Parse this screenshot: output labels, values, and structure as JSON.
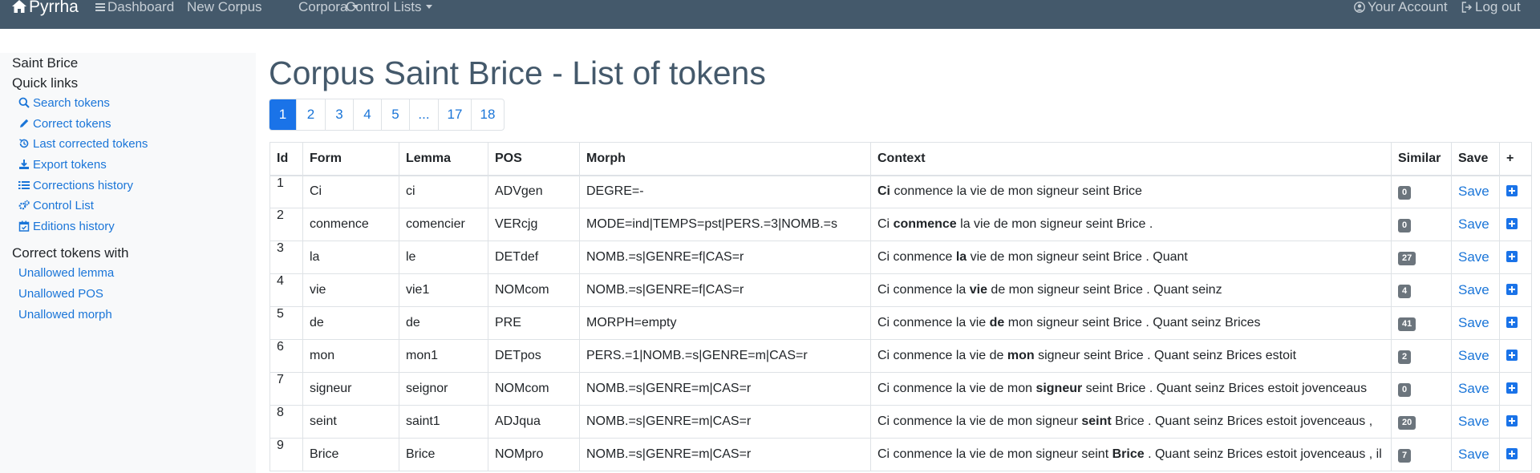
{
  "navbar": {
    "brand": "Pyrrha",
    "dashboard": "Dashboard",
    "new_corpus": "New Corpus",
    "corpora": "Corpora",
    "control_lists": "Control Lists",
    "account": "Your Account",
    "logout": "Log out"
  },
  "sidebar": {
    "corpus_name": "Saint Brice",
    "quick_links_title": "Quick links",
    "links": [
      {
        "label": "Search tokens",
        "icon": "search-icon"
      },
      {
        "label": "Correct tokens",
        "icon": "pencil-icon"
      },
      {
        "label": "Last corrected tokens",
        "icon": "history-icon"
      },
      {
        "label": "Export tokens",
        "icon": "download-icon"
      },
      {
        "label": "Corrections history",
        "icon": "list-icon"
      },
      {
        "label": "Control List",
        "icon": "cogs-icon"
      },
      {
        "label": "Editions history",
        "icon": "calendar-icon"
      }
    ],
    "correct_with_title": "Correct tokens with",
    "correct_links": [
      {
        "label": "Unallowed lemma"
      },
      {
        "label": "Unallowed POS"
      },
      {
        "label": "Unallowed morph"
      }
    ]
  },
  "main": {
    "title": "Corpus Saint Brice - List of tokens",
    "pagination": [
      "1",
      "2",
      "3",
      "4",
      "5",
      "...",
      "17",
      "18"
    ],
    "active_page": "1",
    "table": {
      "headers": [
        "Id",
        "Form",
        "Lemma",
        "POS",
        "Morph",
        "Context",
        "Similar",
        "Save",
        "+"
      ],
      "rows": [
        {
          "id": "1",
          "form": "Ci",
          "lemma": "ci",
          "pos": "ADVgen",
          "morph": "DEGRE=-",
          "ctx_before": "",
          "ctx_token": "Ci",
          "ctx_after": " conmence la vie de mon signeur seint Brice",
          "similar": "0",
          "save": "Save"
        },
        {
          "id": "2",
          "form": "conmence",
          "lemma": "comencier",
          "pos": "VERcjg",
          "morph": "MODE=ind|TEMPS=pst|PERS.=3|NOMB.=s",
          "ctx_before": "Ci ",
          "ctx_token": "conmence",
          "ctx_after": " la vie de mon signeur seint Brice .",
          "similar": "0",
          "save": "Save"
        },
        {
          "id": "3",
          "form": "la",
          "lemma": "le",
          "pos": "DETdef",
          "morph": "NOMB.=s|GENRE=f|CAS=r",
          "ctx_before": "Ci conmence ",
          "ctx_token": "la",
          "ctx_after": " vie de mon signeur seint Brice . Quant",
          "similar": "27",
          "save": "Save"
        },
        {
          "id": "4",
          "form": "vie",
          "lemma": "vie1",
          "pos": "NOMcom",
          "morph": "NOMB.=s|GENRE=f|CAS=r",
          "ctx_before": "Ci conmence la ",
          "ctx_token": "vie",
          "ctx_after": " de mon signeur seint Brice . Quant seinz",
          "similar": "4",
          "save": "Save"
        },
        {
          "id": "5",
          "form": "de",
          "lemma": "de",
          "pos": "PRE",
          "morph": "MORPH=empty",
          "ctx_before": "Ci conmence la vie ",
          "ctx_token": "de",
          "ctx_after": " mon signeur seint Brice . Quant seinz Brices",
          "similar": "41",
          "save": "Save"
        },
        {
          "id": "6",
          "form": "mon",
          "lemma": "mon1",
          "pos": "DETpos",
          "morph": "PERS.=1|NOMB.=s|GENRE=m|CAS=r",
          "ctx_before": "Ci conmence la vie de ",
          "ctx_token": "mon",
          "ctx_after": " signeur seint Brice . Quant seinz Brices estoit",
          "similar": "2",
          "save": "Save"
        },
        {
          "id": "7",
          "form": "signeur",
          "lemma": "seignor",
          "pos": "NOMcom",
          "morph": "NOMB.=s|GENRE=m|CAS=r",
          "ctx_before": "Ci conmence la vie de mon ",
          "ctx_token": "signeur",
          "ctx_after": " seint Brice . Quant seinz Brices estoit jovenceaus",
          "similar": "0",
          "save": "Save"
        },
        {
          "id": "8",
          "form": "seint",
          "lemma": "saint1",
          "pos": "ADJqua",
          "morph": "NOMB.=s|GENRE=m|CAS=r",
          "ctx_before": "Ci conmence la vie de mon signeur ",
          "ctx_token": "seint",
          "ctx_after": " Brice . Quant seinz Brices estoit jovenceaus ,",
          "similar": "20",
          "save": "Save"
        },
        {
          "id": "9",
          "form": "Brice",
          "lemma": "Brice",
          "pos": "NOMpro",
          "morph": "NOMB.=s|GENRE=m|CAS=r",
          "ctx_before": "Ci conmence la vie de mon signeur seint ",
          "ctx_token": "Brice",
          "ctx_after": " . Quant seinz Brices estoit jovenceaus , il",
          "similar": "7",
          "save": "Save"
        }
      ]
    }
  }
}
